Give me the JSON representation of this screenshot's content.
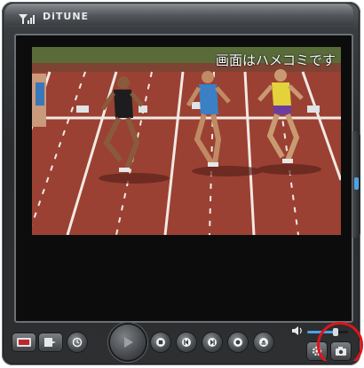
{
  "window": {
    "title": "DiTUNE"
  },
  "screen": {
    "overlay_text": "画面はハメコミです"
  },
  "controls": {
    "volume_level": 0.7
  },
  "icons": {
    "signal": "signal-icon",
    "tv": "tv-icon",
    "export": "export-icon",
    "timer": "timer-icon",
    "play": "play-icon",
    "stop": "stop-icon",
    "previous": "previous-icon",
    "next": "next-icon",
    "record": "record-icon",
    "eject": "eject-icon",
    "volume": "speaker-icon",
    "settings": "settings-icon",
    "camera": "camera-icon"
  },
  "colors": {
    "accent": "#4aa3e6",
    "highlight_ring": "#e0141b"
  }
}
